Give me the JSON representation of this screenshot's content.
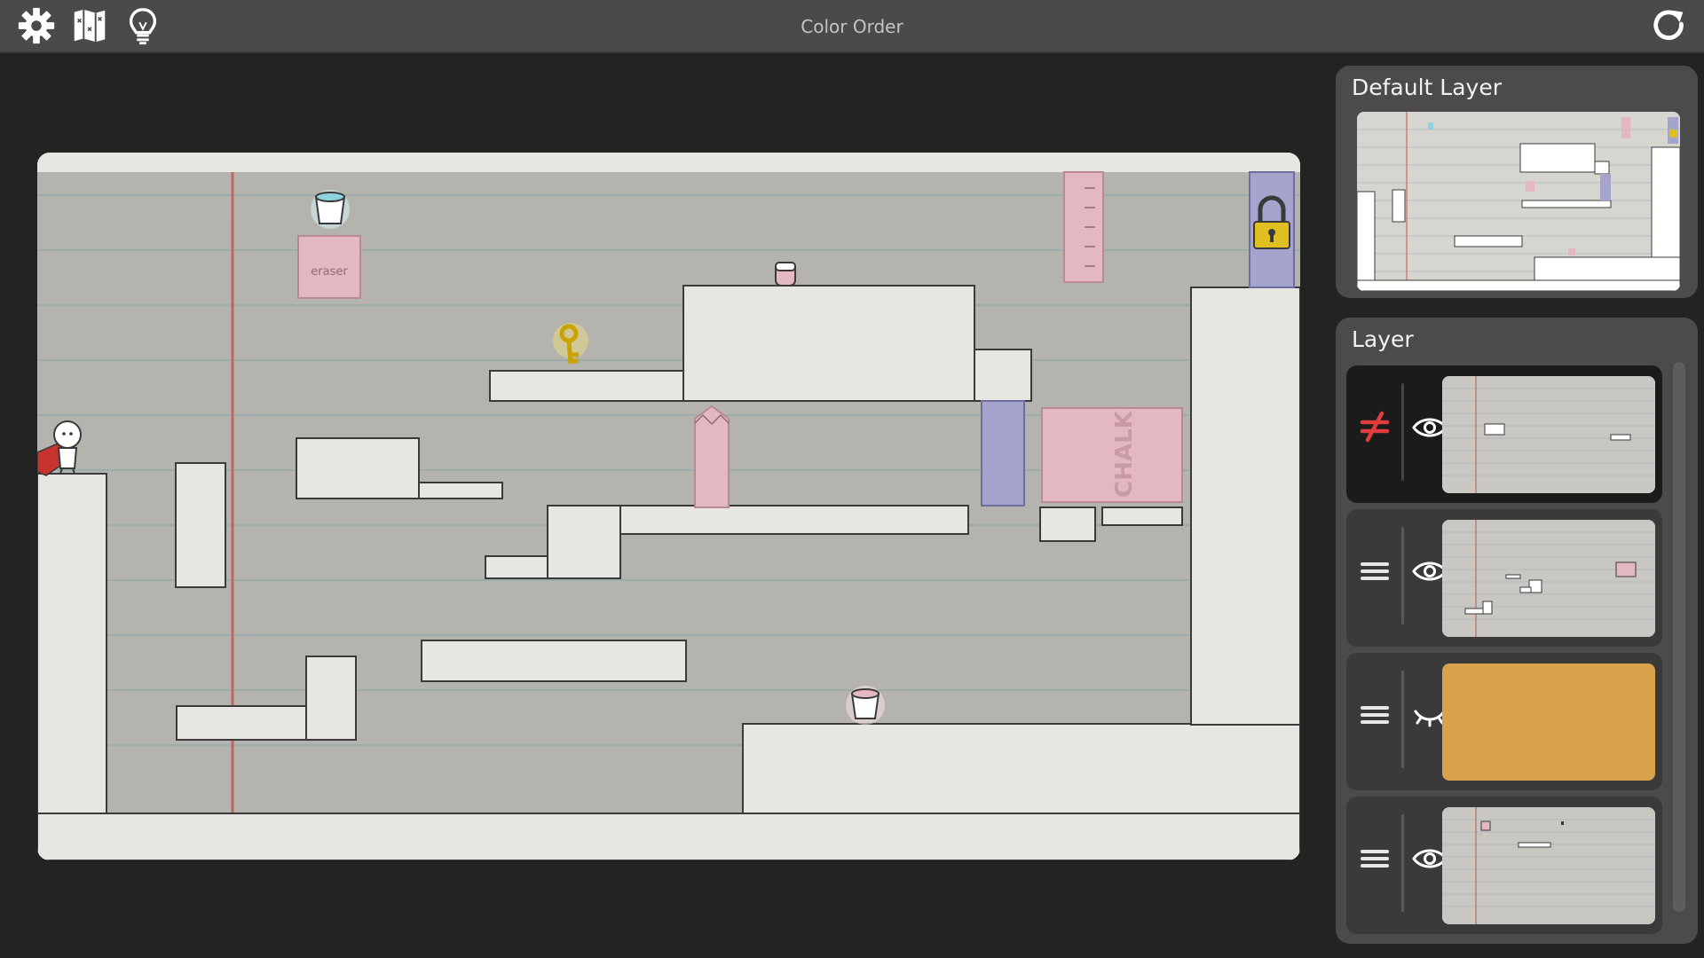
{
  "app": {
    "level_title": "Color Order"
  },
  "toolbar": {
    "settings_icon": "gear-icon",
    "map_icon": "map-icon",
    "hint_icon": "lightbulb-icon",
    "restart_icon": "restart-icon"
  },
  "default_layer": {
    "title": "Default Layer"
  },
  "layers_panel": {
    "title": "Layer",
    "layers": [
      {
        "handle_icon": "not-equal-icon",
        "visibility_icon": "eye-open-icon",
        "thumb_color": "#c9c7c2",
        "active": true
      },
      {
        "handle_icon": "drag-handle-icon",
        "visibility_icon": "eye-open-icon",
        "thumb_color": "#c9c7c2",
        "active": false
      },
      {
        "handle_icon": "drag-handle-icon",
        "visibility_icon": "eye-closed-icon",
        "thumb_color": "#d9a24c",
        "active": false
      },
      {
        "handle_icon": "drag-handle-icon",
        "visibility_icon": "eye-open-icon",
        "thumb_color": "#c9c7c2",
        "active": false
      }
    ]
  },
  "game": {
    "eraser_label": "eraser",
    "chalk_label": "CHALK"
  },
  "colors": {
    "paper": "#e8e6e0",
    "paper_shade": "#b5b3ad",
    "line_blue": "#8fa6ae",
    "margin_red": "#c0554f",
    "pink": "#e3b8c1",
    "purple": "#a5a4cc",
    "gold": "#e0c020",
    "orange": "#d9a24c",
    "accent_red": "#e23b3b"
  }
}
